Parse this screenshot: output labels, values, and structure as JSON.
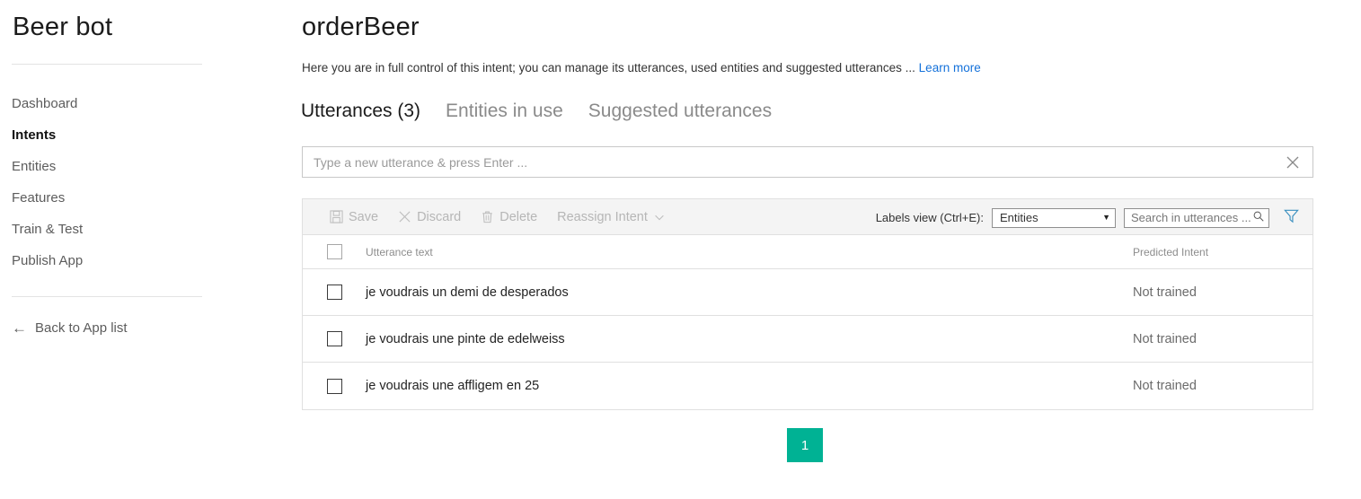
{
  "sidebar": {
    "app_title": "Beer bot",
    "items": [
      {
        "label": "Dashboard",
        "active": false
      },
      {
        "label": "Intents",
        "active": true
      },
      {
        "label": "Entities",
        "active": false
      },
      {
        "label": "Features",
        "active": false
      },
      {
        "label": "Train & Test",
        "active": false
      },
      {
        "label": "Publish App",
        "active": false
      }
    ],
    "back_label": "Back to App list"
  },
  "main": {
    "intent_title": "orderBeer",
    "description": "Here you are in full control of this intent; you can manage its utterances, used entities and suggested utterances ...",
    "learn_more": "Learn more",
    "tabs": [
      {
        "label": "Utterances (3)",
        "active": true
      },
      {
        "label": "Entities in use",
        "active": false
      },
      {
        "label": "Suggested utterances",
        "active": false
      }
    ],
    "new_utterance_placeholder": "Type a new utterance & press Enter ..."
  },
  "toolbar": {
    "save_label": "Save",
    "discard_label": "Discard",
    "delete_label": "Delete",
    "reassign_label": "Reassign Intent",
    "labels_view_label": "Labels view (Ctrl+E):",
    "labels_view_value": "Entities",
    "search_placeholder": "Search in utterances ..."
  },
  "table": {
    "headers": {
      "utterance": "Utterance text",
      "predicted": "Predicted Intent"
    },
    "rows": [
      {
        "utterance": "je voudrais un demi de desperados",
        "predicted": "Not trained",
        "checked": false
      },
      {
        "utterance": "je voudrais une pinte de edelweiss",
        "predicted": "Not trained",
        "checked": false
      },
      {
        "utterance": "je voudrais une affligem en 25",
        "predicted": "Not trained",
        "checked": false
      }
    ]
  },
  "pagination": {
    "current_page": "1"
  },
  "colors": {
    "accent": "#00b294",
    "link": "#1471da",
    "toolbar_bg": "#f4f4f4"
  }
}
